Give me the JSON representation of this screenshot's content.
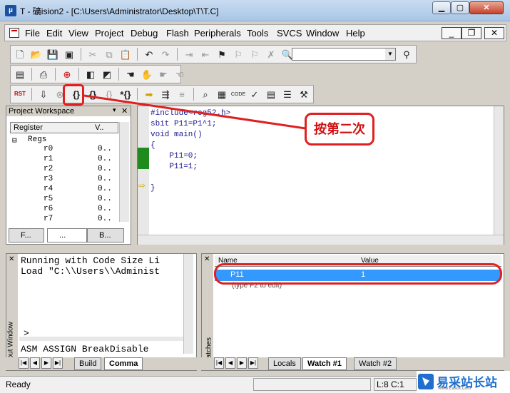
{
  "window": {
    "title": "T  - 礦ision2 - [C:\\Users\\Administrator\\Desktop\\T\\T.C]",
    "icon": "µ"
  },
  "menu": {
    "items": [
      "File",
      "Edit",
      "View",
      "Project",
      "Debug",
      "Flash",
      "Peripherals",
      "Tools",
      "SVCS",
      "Window",
      "Help"
    ]
  },
  "toolbar": {
    "combo_value": ""
  },
  "workspace": {
    "title": "Project Workspace",
    "col_register": "Register",
    "col_value": "V..",
    "root": "Regs",
    "registers": [
      {
        "name": "r0",
        "value": "0.."
      },
      {
        "name": "r1",
        "value": "0.."
      },
      {
        "name": "r2",
        "value": "0.."
      },
      {
        "name": "r3",
        "value": "0.."
      },
      {
        "name": "r4",
        "value": "0.."
      },
      {
        "name": "r5",
        "value": "0.."
      },
      {
        "name": "r6",
        "value": "0.."
      },
      {
        "name": "r7",
        "value": "0.."
      }
    ],
    "tabs": [
      "F...",
      "...",
      "B..."
    ]
  },
  "editor": {
    "lines": [
      "#include<reg52.h>",
      "sbit P11=P1^1;",
      "void main()",
      "{",
      "    P11=0;",
      "    P11=1;",
      "",
      "}"
    ]
  },
  "output": {
    "side_label": "Output Window",
    "lines": [
      "Running with Code Size Li",
      "Load \"C:\\\\Users\\\\Administ"
    ],
    "prompt": ">",
    "command": "ASM ASSIGN BreakDisable",
    "tabs": [
      "Build",
      "Comma"
    ]
  },
  "watch": {
    "side_label": "Watches",
    "col_name": "Name",
    "col_value": "Value",
    "rows": [
      {
        "name": "P11",
        "value": "1"
      }
    ],
    "hint": "(type F2 to edit)",
    "tabs": [
      "Locals",
      "Watch #1",
      "Watch #2"
    ]
  },
  "status": {
    "ready": "Ready",
    "position": "L:8 C:1"
  },
  "annotation": {
    "callout": "按第二次",
    "color": "#e02020"
  },
  "watermark": {
    "text": "易采站长站",
    "url": "Www.Easck.Com"
  }
}
